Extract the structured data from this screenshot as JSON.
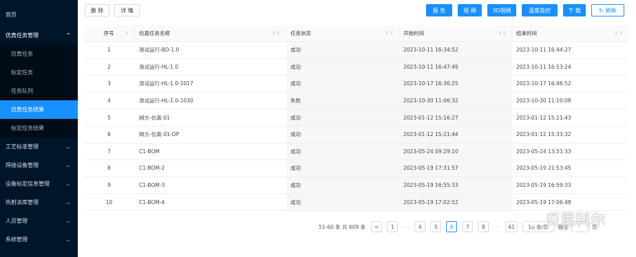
{
  "sidebar": {
    "items": [
      {
        "label": "首页",
        "type": "top"
      },
      {
        "label": "仿真任务管理",
        "type": "open-group"
      },
      {
        "label": "仿真任务",
        "type": "sub"
      },
      {
        "label": "标定任务",
        "type": "sub"
      },
      {
        "label": "任务队列",
        "type": "sub"
      },
      {
        "label": "仿真任务结果",
        "type": "sub-active"
      },
      {
        "label": "标定任务结果",
        "type": "sub"
      },
      {
        "label": "工艺标准管理",
        "type": "group"
      },
      {
        "label": "焊接设备管理",
        "type": "group"
      },
      {
        "label": "设备标定信息管理",
        "type": "group"
      },
      {
        "label": "热射派库管理",
        "type": "group"
      },
      {
        "label": "人员管理",
        "type": "group"
      },
      {
        "label": "系统管理",
        "type": "group"
      }
    ]
  },
  "toolbar": {
    "delete_label": "删 除",
    "detail_label": "详 情",
    "report_label": "报 告",
    "video_label": "视 频",
    "video3d_label": "3D视频",
    "temp_monitor_label": "温度监控",
    "download_label": "下 载",
    "refresh_label": "刷新"
  },
  "table": {
    "columns": [
      "序号",
      "仿真任务名称",
      "任务状态",
      "开始时间",
      "结束时间"
    ],
    "rows": [
      [
        "1",
        "测试运行-BD-1.0",
        "成功",
        "2023-10-11 16:34:52",
        "2023-10-11 16:44:27"
      ],
      [
        "2",
        "测试运行-HL-1.0",
        "成功",
        "2023-10-11 16:47:49",
        "2023-10-11 16:53:24"
      ],
      [
        "3",
        "测试运行-HL-1.0-1017",
        "成功",
        "2023-10-17 16:36:25",
        "2023-10-17 16:46:52"
      ],
      [
        "4",
        "测试运行-HL-1.0-1030",
        "失败",
        "2023-10-30 11:06:32",
        "2023-10-30 11:10:08"
      ],
      [
        "5",
        "网方-仿真-01",
        "成功",
        "2023-01-12 15:16:27",
        "2023-01-12 15:21:43"
      ],
      [
        "6",
        "网方-仿真-01-OP",
        "成功",
        "2023-01-12 15:21:44",
        "2023-01-12 15:33:32"
      ],
      [
        "7",
        "C1-BOM",
        "成功",
        "2023-05-24 09:29:10",
        "2023-05-24 13:51:33"
      ],
      [
        "8",
        "C1-BOM-2",
        "成功",
        "2023-05-19 17:31:57",
        "2023-05-19 21:53:45"
      ],
      [
        "9",
        "C1-BOM-3",
        "成功",
        "2023-05-19 16:55:33",
        "2023-05-19 16:59:33"
      ],
      [
        "10",
        "C1-BOM-4",
        "成功",
        "2023-05-19 17:02:52",
        "2023-05-19 17:06:48"
      ]
    ]
  },
  "pagination": {
    "total_text": "51-60 条 共 609 条",
    "prev": "<",
    "pages": [
      "1",
      "4",
      "5",
      "6",
      "7",
      "8",
      "61"
    ],
    "current": "6",
    "page_size": "10 条/页",
    "jump_label": "跳至",
    "page_suffix": "页"
  },
  "watermark": {
    "text": "贝思科尔"
  },
  "colors": {
    "sidebar_bg": "#001529",
    "accent": "#1890ff"
  }
}
